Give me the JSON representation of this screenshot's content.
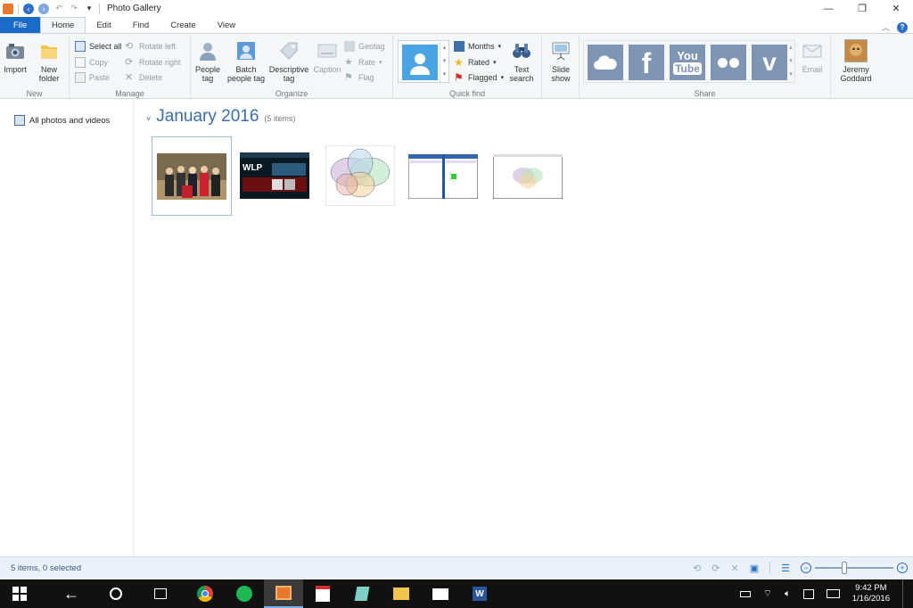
{
  "window": {
    "title": "Photo Gallery"
  },
  "tabs": [
    "File",
    "Home",
    "Edit",
    "Find",
    "Create",
    "View"
  ],
  "ribbon": {
    "new": {
      "label": "New",
      "import": "Import",
      "new_folder": "New folder"
    },
    "manage": {
      "label": "Manage",
      "select_all": "Select all",
      "copy": "Copy",
      "paste": "Paste",
      "rotate_left": "Rotate left",
      "rotate_right": "Rotate right",
      "delete": "Delete"
    },
    "organize": {
      "label": "Organize",
      "people_tag": "People tag",
      "batch_people_tag": "Batch people tag",
      "descriptive_tag": "Descriptive tag",
      "caption": "Caption",
      "geotag": "Geotag",
      "rate": "Rate",
      "flag": "Flag"
    },
    "quick_find": {
      "label": "Quick find",
      "months": "Months",
      "rated": "Rated",
      "flagged": "Flagged",
      "text_search": "Text search"
    },
    "slideshow": {
      "label": "Slide show"
    },
    "share": {
      "label": "Share",
      "email": "Email"
    },
    "account": {
      "name": "Jeremy Goddard"
    }
  },
  "nav": {
    "all_photos": "All photos and videos"
  },
  "main": {
    "group_title": "January 2016",
    "group_count": "(5 items)"
  },
  "status": {
    "text": "5 items, 0 selected"
  },
  "taskbar": {
    "time": "9:42 PM",
    "date": "1/16/2016"
  },
  "colors": {
    "accent": "#1b6cc9",
    "heading": "#3b6ea8",
    "share_tiles": "#7f95b4"
  },
  "icons": [
    "import-icon",
    "folder-icon",
    "select-all-icon",
    "copy-icon",
    "paste-icon",
    "rotate-left-icon",
    "rotate-right-icon",
    "delete-icon",
    "person-icon",
    "geotag-icon",
    "star-icon",
    "flag-icon",
    "calendar-icon",
    "binoculars-icon",
    "projector-icon",
    "onedrive-icon",
    "facebook-icon",
    "youtube-icon",
    "flickr-icon",
    "vimeo-icon",
    "email-icon",
    "help-icon"
  ]
}
